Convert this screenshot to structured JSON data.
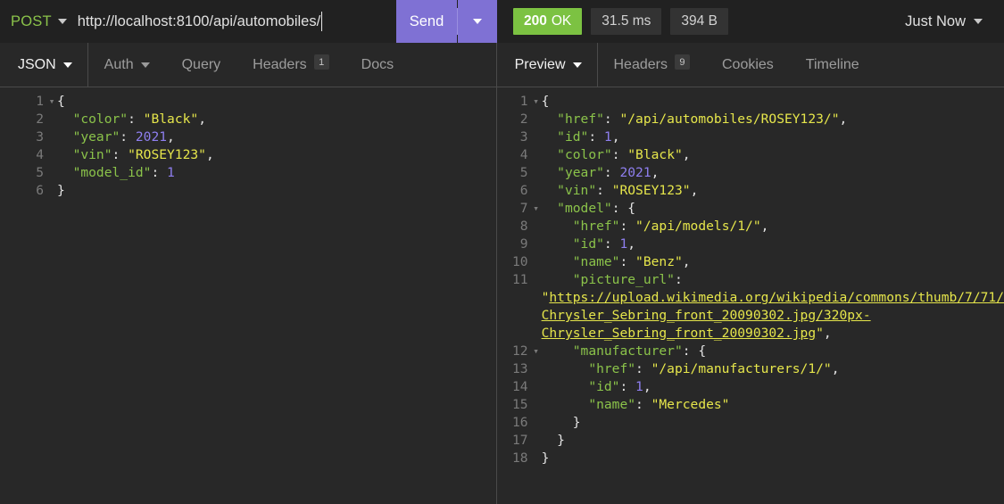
{
  "request_bar": {
    "method": "POST",
    "method_caret": "chevron-down-icon",
    "url": "http://localhost:8100/api/automobiles/",
    "send_label": "Send",
    "send_caret": "chevron-down-icon"
  },
  "status_bar": {
    "status_code": "200",
    "status_text": "OK",
    "time": "31.5 ms",
    "size": "394 B",
    "timestamp_label": "Just Now",
    "timestamp_caret": "chevron-down-icon",
    "status_color": "#7cc242"
  },
  "request_panel": {
    "tabs": [
      {
        "label": "JSON",
        "caret": true,
        "badge": null,
        "active": true
      },
      {
        "label": "Auth",
        "caret": true,
        "badge": null,
        "active": false
      },
      {
        "label": "Query",
        "caret": false,
        "badge": null,
        "active": false
      },
      {
        "label": "Headers",
        "caret": false,
        "badge": "1",
        "active": false
      },
      {
        "label": "Docs",
        "caret": false,
        "badge": null,
        "active": false
      }
    ],
    "body_lines": [
      {
        "num": "1",
        "fold": true,
        "html": "<span class=\"p\">{</span>"
      },
      {
        "num": "2",
        "fold": false,
        "html": "  <span class=\"k\">\"color\"</span><span class=\"p\">: </span><span class=\"s\">\"Black\"</span><span class=\"p\">,</span>"
      },
      {
        "num": "3",
        "fold": false,
        "html": "  <span class=\"k\">\"year\"</span><span class=\"p\">: </span><span class=\"n\">2021</span><span class=\"p\">,</span>"
      },
      {
        "num": "4",
        "fold": false,
        "html": "  <span class=\"k\">\"vin\"</span><span class=\"p\">: </span><span class=\"s\">\"ROSEY123\"</span><span class=\"p\">,</span>"
      },
      {
        "num": "5",
        "fold": false,
        "html": "  <span class=\"k\">\"model_id\"</span><span class=\"p\">: </span><span class=\"n\">1</span>"
      },
      {
        "num": "6",
        "fold": false,
        "html": "<span class=\"p\">}</span>"
      }
    ]
  },
  "response_panel": {
    "tabs": [
      {
        "label": "Preview",
        "caret": true,
        "badge": null,
        "active": true
      },
      {
        "label": "Headers",
        "caret": false,
        "badge": "9",
        "active": false
      },
      {
        "label": "Cookies",
        "caret": false,
        "badge": null,
        "active": false
      },
      {
        "label": "Timeline",
        "caret": false,
        "badge": null,
        "active": false
      }
    ],
    "body_lines": [
      {
        "num": "1",
        "fold": true,
        "html": "<span class=\"p\">{</span>"
      },
      {
        "num": "2",
        "fold": false,
        "html": "  <span class=\"k\">\"href\"</span><span class=\"p\">: </span><span class=\"s\">\"/api/automobiles/ROSEY123/\"</span><span class=\"p\">,</span>"
      },
      {
        "num": "3",
        "fold": false,
        "html": "  <span class=\"k\">\"id\"</span><span class=\"p\">: </span><span class=\"n\">1</span><span class=\"p\">,</span>"
      },
      {
        "num": "4",
        "fold": false,
        "html": "  <span class=\"k\">\"color\"</span><span class=\"p\">: </span><span class=\"s\">\"Black\"</span><span class=\"p\">,</span>"
      },
      {
        "num": "5",
        "fold": false,
        "html": "  <span class=\"k\">\"year\"</span><span class=\"p\">: </span><span class=\"n\">2021</span><span class=\"p\">,</span>"
      },
      {
        "num": "6",
        "fold": false,
        "html": "  <span class=\"k\">\"vin\"</span><span class=\"p\">: </span><span class=\"s\">\"ROSEY123\"</span><span class=\"p\">,</span>"
      },
      {
        "num": "7",
        "fold": true,
        "html": "  <span class=\"k\">\"model\"</span><span class=\"p\">: {</span>"
      },
      {
        "num": "8",
        "fold": false,
        "html": "    <span class=\"k\">\"href\"</span><span class=\"p\">: </span><span class=\"s\">\"/api/models/1/\"</span><span class=\"p\">,</span>"
      },
      {
        "num": "9",
        "fold": false,
        "html": "    <span class=\"k\">\"id\"</span><span class=\"p\">: </span><span class=\"n\">1</span><span class=\"p\">,</span>"
      },
      {
        "num": "10",
        "fold": false,
        "html": "    <span class=\"k\">\"name\"</span><span class=\"p\">: </span><span class=\"s\">\"Benz\"</span><span class=\"p\">,</span>"
      },
      {
        "num": "11",
        "fold": false,
        "html": "    <span class=\"k\">\"picture_url\"</span><span class=\"p\">:</span>"
      },
      {
        "num": "",
        "fold": false,
        "html": "<span class=\"s\">\"</span><span class=\"lnk\">https://upload.wikimedia.org/wikipedia/commons/thumb/7/71/</span>"
      },
      {
        "num": "",
        "fold": false,
        "html": "<span class=\"lnk\">Chrysler_Sebring_front_20090302.jpg/320px-</span>"
      },
      {
        "num": "",
        "fold": false,
        "html": "<span class=\"lnk\">Chrysler_Sebring_front_20090302.jpg</span><span class=\"s\">\"</span><span class=\"p\">,</span>"
      },
      {
        "num": "12",
        "fold": true,
        "html": "    <span class=\"k\">\"manufacturer\"</span><span class=\"p\">: {</span>"
      },
      {
        "num": "13",
        "fold": false,
        "html": "      <span class=\"k\">\"href\"</span><span class=\"p\">: </span><span class=\"s\">\"/api/manufacturers/1/\"</span><span class=\"p\">,</span>"
      },
      {
        "num": "14",
        "fold": false,
        "html": "      <span class=\"k\">\"id\"</span><span class=\"p\">: </span><span class=\"n\">1</span><span class=\"p\">,</span>"
      },
      {
        "num": "15",
        "fold": false,
        "html": "      <span class=\"k\">\"name\"</span><span class=\"p\">: </span><span class=\"s\">\"Mercedes\"</span>"
      },
      {
        "num": "16",
        "fold": false,
        "html": "    <span class=\"p\">}</span>"
      },
      {
        "num": "17",
        "fold": false,
        "html": "  <span class=\"p\">}</span>"
      },
      {
        "num": "18",
        "fold": false,
        "html": "<span class=\"p\">}</span>"
      }
    ]
  }
}
